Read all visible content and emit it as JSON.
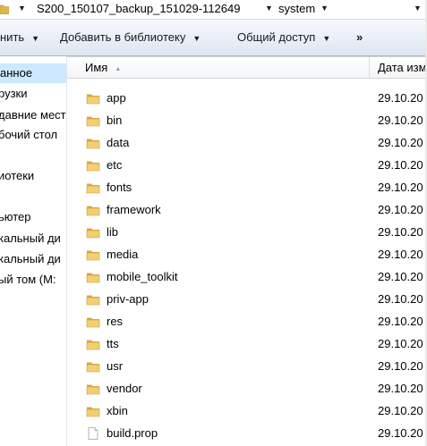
{
  "address_bar": {
    "segment_1": "S200_150107_backup_151029-112649",
    "segment_2": "system"
  },
  "toolbar": {
    "share_label": "нить",
    "library_label": "Добавить в библиотеку",
    "access_label": "Общий доступ",
    "more_label": "»"
  },
  "nav_pane": {
    "items": [
      "анное",
      "рузки",
      "давние мест",
      "бочий стол",
      "иотеки",
      "ьютер",
      "кальный ди",
      "кальный ди",
      "ый том (M:"
    ]
  },
  "file_list": {
    "columns": {
      "name": "Имя",
      "date": "Дата изм"
    },
    "rows": [
      {
        "name": "app",
        "type": "folder",
        "date": "29.10.20"
      },
      {
        "name": "bin",
        "type": "folder",
        "date": "29.10.20"
      },
      {
        "name": "data",
        "type": "folder",
        "date": "29.10.20"
      },
      {
        "name": "etc",
        "type": "folder",
        "date": "29.10.20"
      },
      {
        "name": "fonts",
        "type": "folder",
        "date": "29.10.20"
      },
      {
        "name": "framework",
        "type": "folder",
        "date": "29.10.20"
      },
      {
        "name": "lib",
        "type": "folder",
        "date": "29.10.20"
      },
      {
        "name": "media",
        "type": "folder",
        "date": "29.10.20"
      },
      {
        "name": "mobile_toolkit",
        "type": "folder",
        "date": "29.10.20"
      },
      {
        "name": "priv-app",
        "type": "folder",
        "date": "29.10.20"
      },
      {
        "name": "res",
        "type": "folder",
        "date": "29.10.20"
      },
      {
        "name": "tts",
        "type": "folder",
        "date": "29.10.20"
      },
      {
        "name": "usr",
        "type": "folder",
        "date": "29.10.20"
      },
      {
        "name": "vendor",
        "type": "folder",
        "date": "29.10.20"
      },
      {
        "name": "xbin",
        "type": "folder",
        "date": "29.10.20"
      },
      {
        "name": "build.prop",
        "type": "file",
        "date": "29.10.20"
      }
    ]
  },
  "colors": {
    "selection": "#cde8ff",
    "folder": "#e8c15f",
    "toolbar_bg": "#e8eef6"
  }
}
